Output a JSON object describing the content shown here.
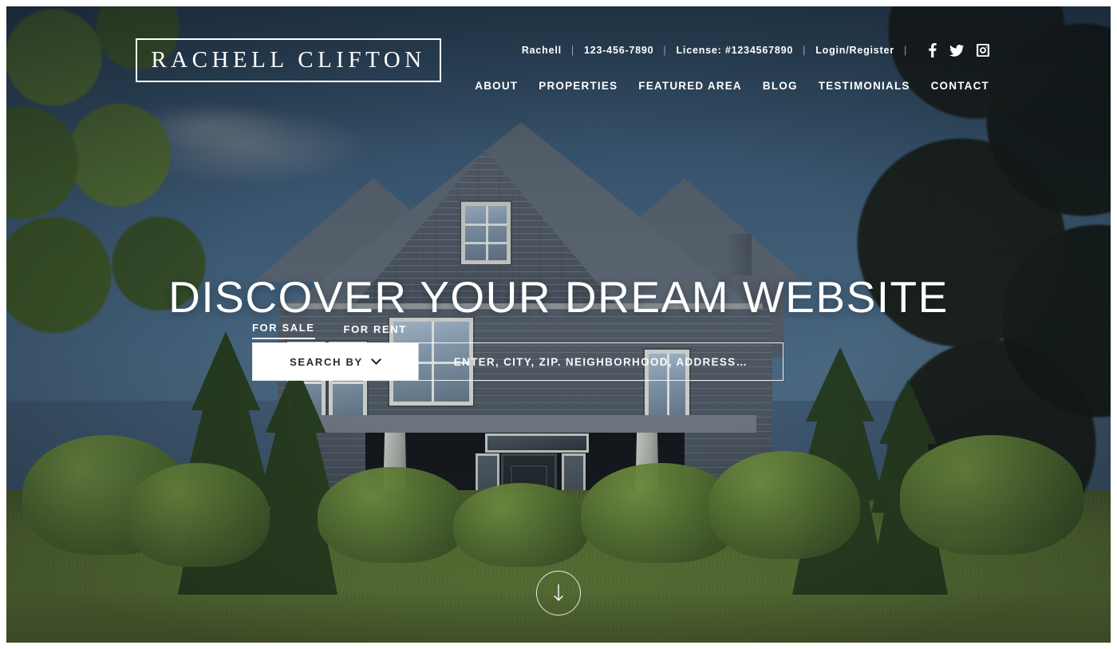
{
  "brand": {
    "logo_text": "RACHELL CLIFTON"
  },
  "topbar": {
    "agent_name": "Rachell",
    "phone": "123-456-7890",
    "license": "License: #1234567890",
    "login_label": "Login/Register",
    "separator": "|",
    "social": [
      {
        "name": "facebook-icon",
        "label": "Facebook"
      },
      {
        "name": "twitter-icon",
        "label": "Twitter"
      },
      {
        "name": "instagram-icon",
        "label": "Instagram"
      }
    ]
  },
  "nav": {
    "items": [
      {
        "label": "ABOUT"
      },
      {
        "label": "PROPERTIES"
      },
      {
        "label": "FEATURED AREA"
      },
      {
        "label": "BLOG"
      },
      {
        "label": "TESTIMONIALS"
      },
      {
        "label": "CONTACT"
      }
    ]
  },
  "hero": {
    "title": "DISCOVER YOUR DREAM WEBSITE",
    "tabs": [
      {
        "label": "FOR SALE",
        "active": true
      },
      {
        "label": "FOR RENT",
        "active": false
      }
    ],
    "search": {
      "search_by_label": "SEARCH BY",
      "input_value": "",
      "placeholder": "ENTER, CITY, ZIP. NEIGHBORHOOD, ADDRESS…"
    },
    "scroll_hint": "Scroll down"
  },
  "colors": {
    "sky": "#3d5770",
    "house": "#596470",
    "lawn": "#6d8a3a",
    "text_light": "#ffffff",
    "accent_panel": "#ffffff"
  }
}
